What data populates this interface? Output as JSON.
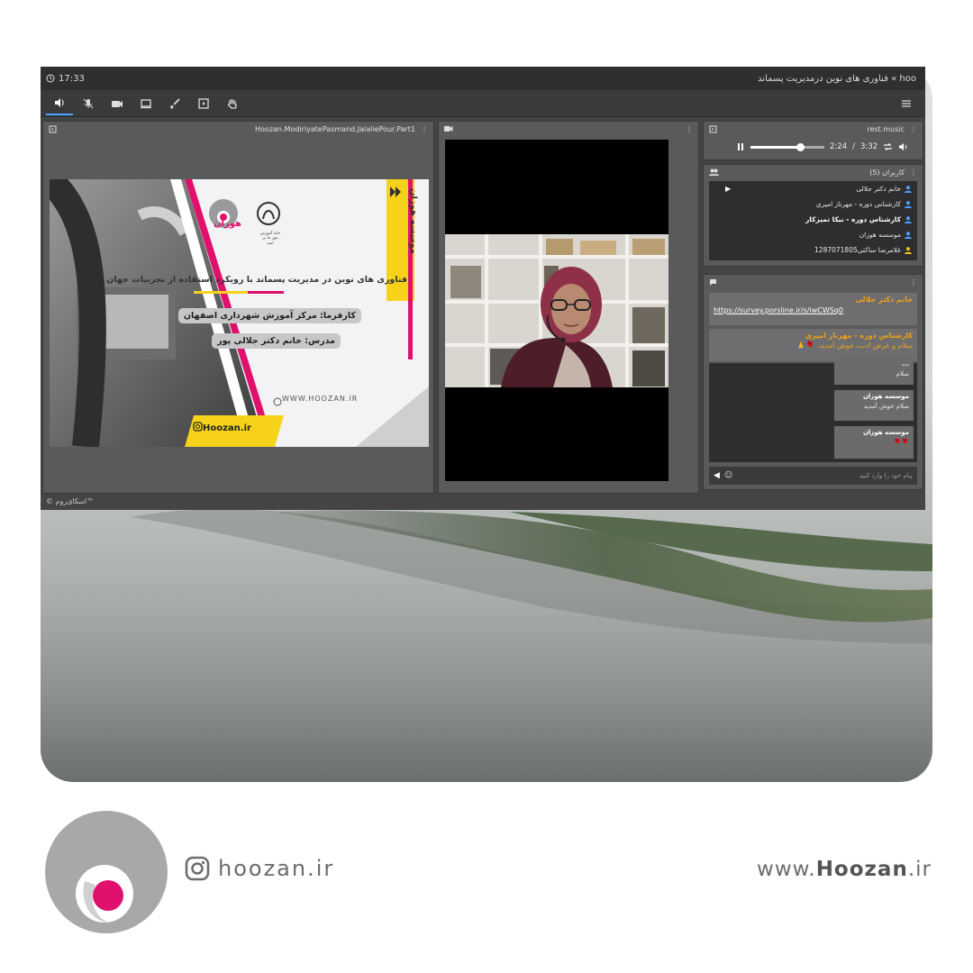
{
  "titlebar": {
    "time": "17:33",
    "breadcrumb": "hoo » فناوری های نوین درمدیریت پسماند"
  },
  "presentation": {
    "file_name": "Hoozan.ModiriyatePasmand.JalaliePour.Part1",
    "brand_vertical": "موسسه هوزان",
    "logo_text": "هوزان",
    "logo_caption": "خانه آموزش مهر ما پر امید",
    "slide_title": "فناوری های نوین در مدیریت پسماند با رویکرد استفاده از تجربیات جهان",
    "employer_line": "کارفرما: مرکز آموزش شهرداری اصفهان",
    "teacher_line": "مدرس: خانم دکتر جلالی پور",
    "site": "WWW.HOOZAN.IR",
    "instagram": "Hoozan.ir"
  },
  "music": {
    "title": "rest.music",
    "current": "2:24",
    "separator": "/",
    "duration": "3:32",
    "progress": 0.68
  },
  "users": {
    "title": "کاربران (5)",
    "items": [
      {
        "name": "خانم دکتر جلالی",
        "camera": true,
        "bold": false,
        "color": "#4aa3ff"
      },
      {
        "name": "کارشناس دوره - مهرناز امیری",
        "camera": false,
        "bold": false,
        "color": "#4aa3ff"
      },
      {
        "name": "کارشناس دوره - نیکا تمیزکار",
        "camera": false,
        "bold": true,
        "color": "#4aa3ff"
      },
      {
        "name": "موسسه هوزان",
        "camera": false,
        "bold": false,
        "color": "#4aa3ff"
      },
      {
        "name": "غلامرضا ساکتی1287071805",
        "camera": false,
        "bold": false,
        "color": "#f2c21a"
      }
    ]
  },
  "chat": {
    "pinned": [
      {
        "name": "خانم دکتر جلالی",
        "text": "https://survey.porsline.ir/s/iwCWSq0",
        "is_link": true
      },
      {
        "name": "کارشناس دوره - مهرناز امیری",
        "text": "سلام و عرض ادب، خوش آمدید.",
        "is_link": false
      }
    ],
    "messages": [
      {
        "name": "...",
        "text": "سلام"
      },
      {
        "name": "موسسه هوزان",
        "text": "سلام خوش آمدید"
      },
      {
        "name": "موسسه هوزان",
        "text": "🌹🌹"
      }
    ],
    "input_placeholder": "پیام خود را وارد کنید"
  },
  "statusbar": {
    "text": "© اسکای‌روم™"
  },
  "footer": {
    "instagram_handle": "hoozan.ir",
    "website_prefix": "www.",
    "website_brand": "Hoozan",
    "website_suffix": ".ir"
  },
  "colors": {
    "accent": "#e0106d",
    "brand_yellow": "#f7d21b",
    "chat_orange": "#f2a114",
    "app_bg": "#444446"
  }
}
